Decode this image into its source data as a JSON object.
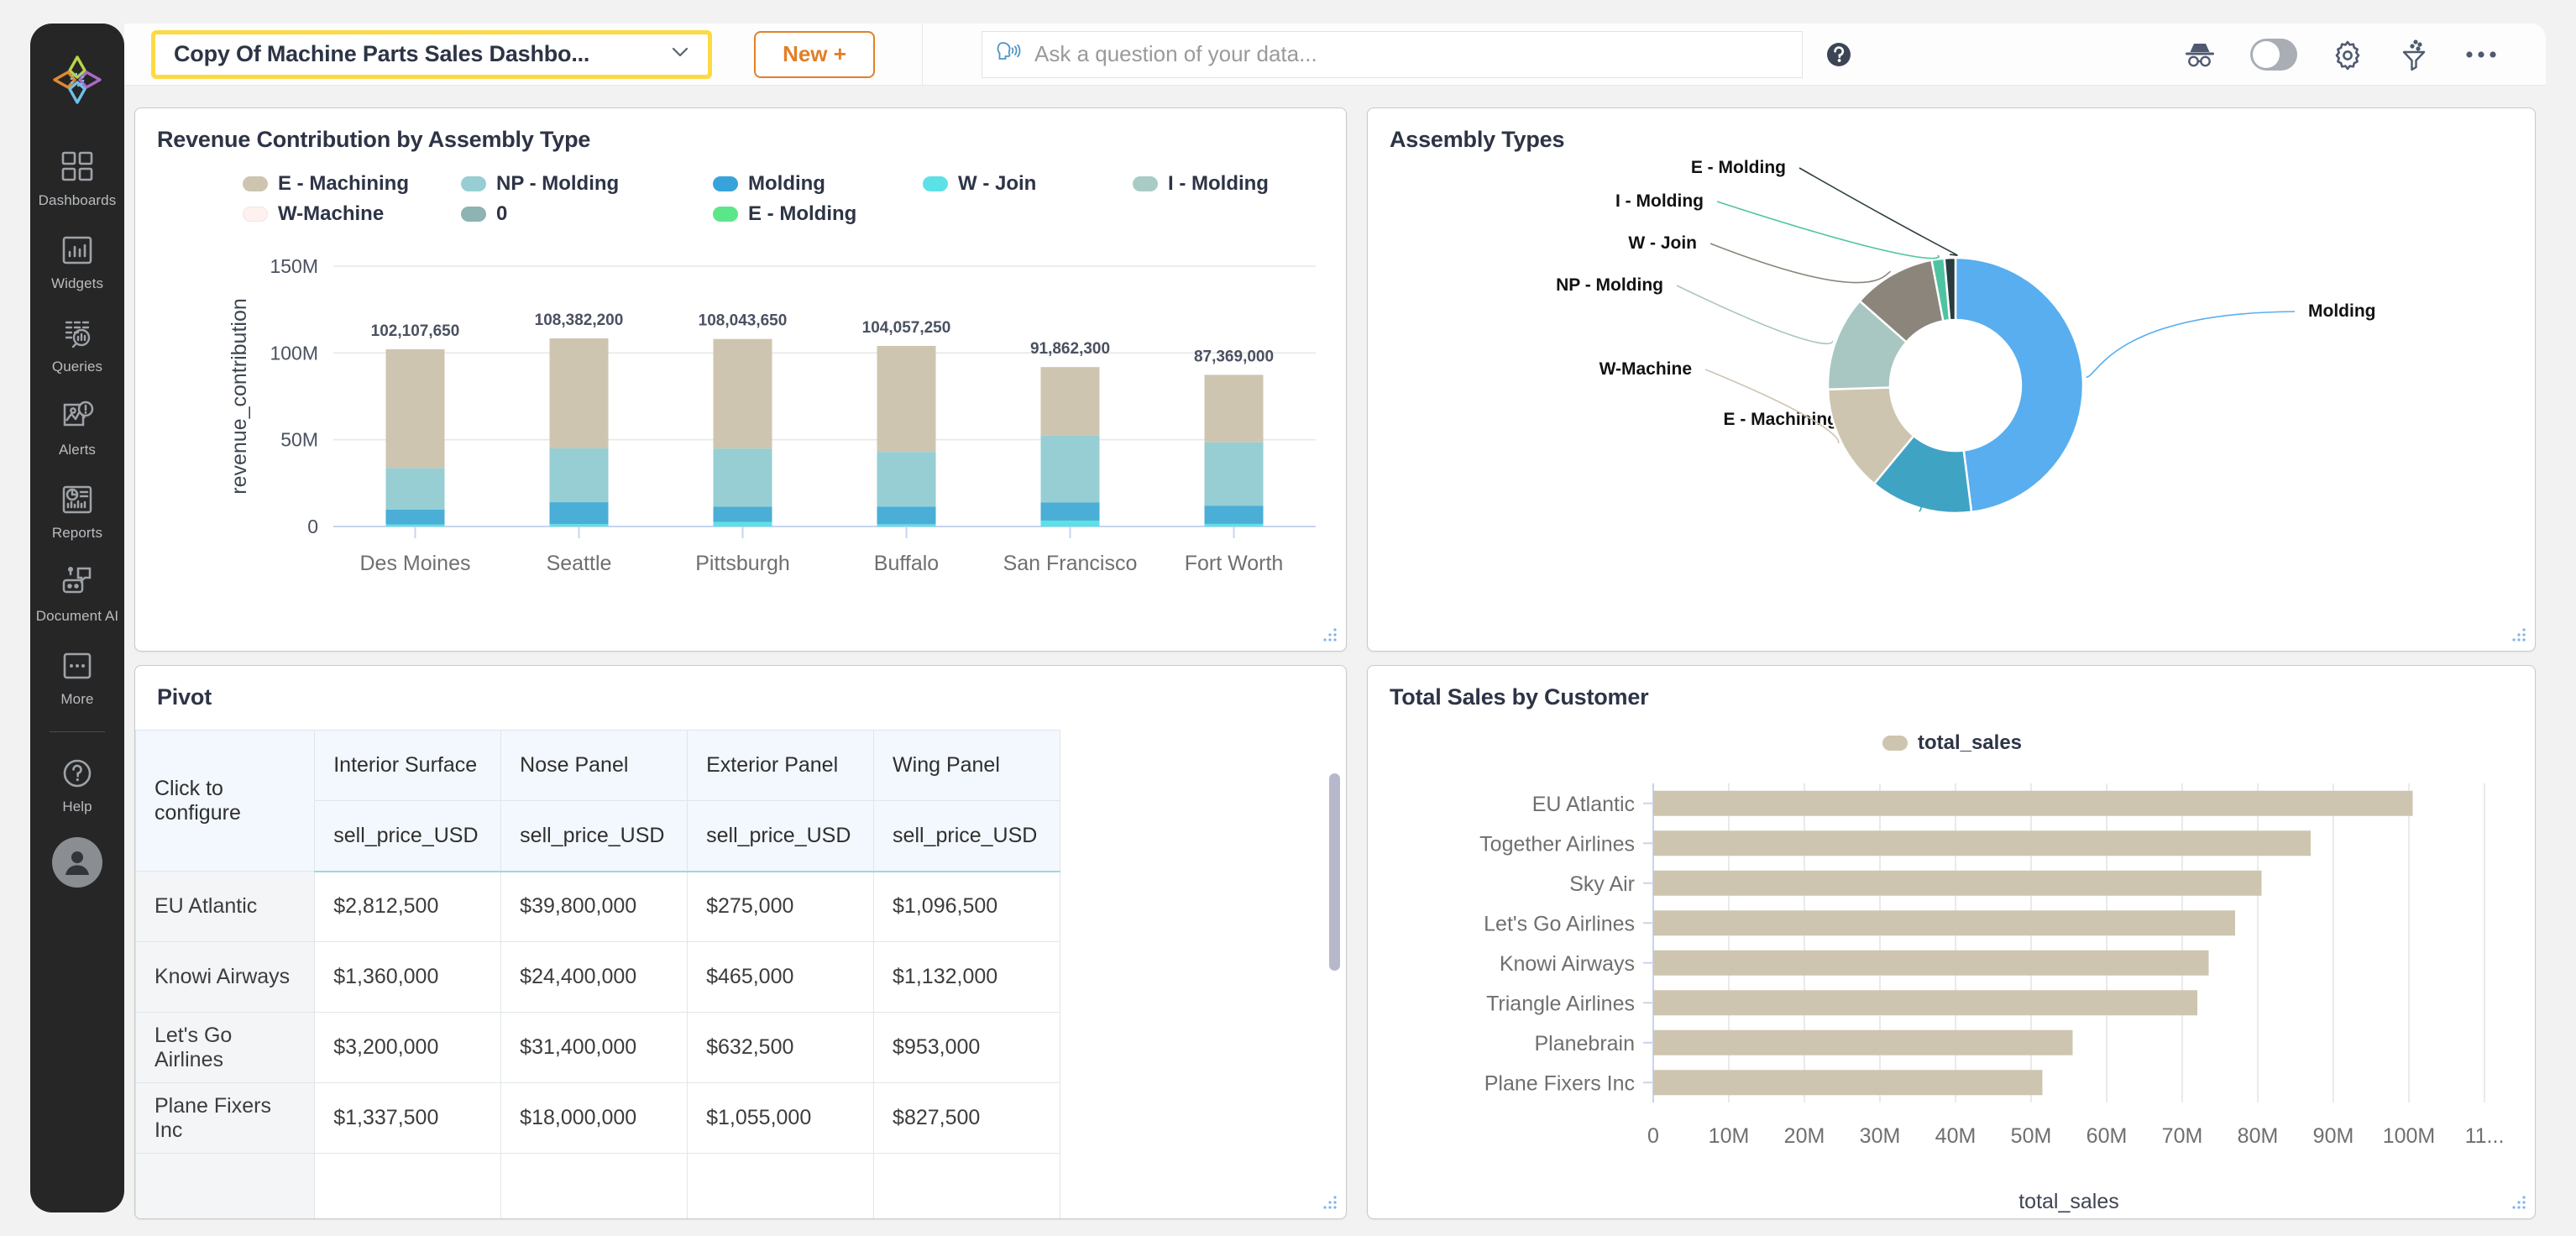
{
  "app": {
    "logo_icon": "knowi-star-logo"
  },
  "sidebar": {
    "items": [
      {
        "label": "Dashboards",
        "icon": "dashboards-icon"
      },
      {
        "label": "Widgets",
        "icon": "widgets-icon"
      },
      {
        "label": "Queries",
        "icon": "queries-icon"
      },
      {
        "label": "Alerts",
        "icon": "alerts-icon"
      },
      {
        "label": "Reports",
        "icon": "reports-icon"
      },
      {
        "label": "Document AI",
        "icon": "document-ai-icon"
      },
      {
        "label": "More",
        "icon": "more-icon"
      }
    ],
    "help": {
      "label": "Help",
      "icon": "help-circle-icon"
    },
    "avatar_icon": "user-avatar-icon"
  },
  "toolbar": {
    "dashboard_name": "Copy Of Machine Parts Sales Dashbo...",
    "dashboard_caret_icon": "chevron-down-icon",
    "new_label": "New +",
    "ask": {
      "placeholder": "Ask a question of your data...",
      "icon": "speak-head-icon"
    },
    "help_icon": "help-question-icon",
    "incognito_icon": "incognito-hat-icon",
    "toggle_icon": "toggle-switch",
    "settings_icon": "gear-icon",
    "filter_icon": "filter-funnel-icon",
    "more_icon": "ellipsis-icon",
    "highlight_color": "#ffd943",
    "new_button_color": "#e08028"
  },
  "panels": {
    "bar": {
      "title": "Revenue Contribution by Assembly Type",
      "resize_icon": "resize-handle-icon"
    },
    "donut": {
      "title": "Assembly Types",
      "resize_icon": "resize-handle-icon"
    },
    "pivot": {
      "title": "Pivot",
      "resize_icon": "resize-handle-icon"
    },
    "hbar": {
      "title": "Total Sales by Customer",
      "resize_icon": "resize-handle-icon"
    }
  },
  "pivot": {
    "corner_label": "Click to configure",
    "columns": [
      "Interior Surface",
      "Nose Panel",
      "Exterior Panel",
      "Wing Panel"
    ],
    "measure_label": "sell_price_USD",
    "rows": [
      {
        "name": "EU Atlantic",
        "values": [
          "$2,812,500",
          "$39,800,000",
          "$275,000",
          "$1,096,500"
        ]
      },
      {
        "name": "Knowi Airways",
        "values": [
          "$1,360,000",
          "$24,400,000",
          "$465,000",
          "$1,132,000"
        ]
      },
      {
        "name": "Let's Go Airlines",
        "values": [
          "$3,200,000",
          "$31,400,000",
          "$632,500",
          "$953,000"
        ]
      },
      {
        "name": "Plane Fixers Inc",
        "values": [
          "$1,337,500",
          "$18,000,000",
          "$1,055,000",
          "$827,500"
        ]
      }
    ]
  },
  "chart_data": [
    {
      "id": "revenue-contribution-bar",
      "type": "bar",
      "stacked": true,
      "title": "Revenue Contribution by Assembly Type",
      "xlabel": "",
      "ylabel": "revenue_contribution",
      "ylim": [
        0,
        150000000
      ],
      "yticks": [
        0,
        50000000,
        100000000,
        150000000
      ],
      "ytick_labels": [
        "0",
        "50M",
        "100M",
        "150M"
      ],
      "grid": true,
      "legend_position": "top",
      "categories": [
        "Des Moines",
        "Seattle",
        "Pittsburgh",
        "Buffalo",
        "San Francisco",
        "Fort Worth"
      ],
      "totals": [
        102107650,
        108382200,
        108043650,
        104057250,
        91862300,
        87369000
      ],
      "total_labels": [
        "102,107,650",
        "108,382,200",
        "108,043,650",
        "104,057,250",
        "91,862,300",
        "87,369,000"
      ],
      "series": [
        {
          "name": "W - Join",
          "color": "#5ce1e6",
          "values": [
            1200000,
            1400000,
            2600000,
            1300000,
            3400000,
            1500000
          ]
        },
        {
          "name": "Molding",
          "color": "#4aaed6",
          "values": [
            8500000,
            12600000,
            8800000,
            10200000,
            10400000,
            10500000
          ]
        },
        {
          "name": "NP - Molding",
          "color": "#96ced3",
          "values": [
            24000000,
            31000000,
            33500000,
            31500000,
            38800000,
            36500000
          ]
        },
        {
          "name": "E - Machining",
          "color": "#cec5b0",
          "values": [
            68407650,
            63382200,
            63143650,
            61057250,
            39262300,
            38869000
          ]
        },
        {
          "name": "W-Machine",
          "color": "#fdf2ee",
          "values": [
            0,
            0,
            0,
            0,
            0,
            0
          ]
        },
        {
          "name": "0",
          "color": "#8db3b2",
          "values": [
            0,
            0,
            0,
            0,
            0,
            0
          ]
        },
        {
          "name": "E - Molding",
          "color": "#5ce68a",
          "values": [
            0,
            0,
            0,
            0,
            0,
            0
          ]
        },
        {
          "name": "I - Molding",
          "color": "#a8ccc5",
          "values": [
            0,
            0,
            0,
            0,
            0,
            0
          ]
        }
      ],
      "legend": [
        {
          "label": "E - Machining",
          "color": "#cec5b0"
        },
        {
          "label": "NP - Molding",
          "color": "#96ced3"
        },
        {
          "label": "Molding",
          "color": "#38a3da"
        },
        {
          "label": "W - Join",
          "color": "#5ce1e6"
        },
        {
          "label": "I - Molding",
          "color": "#a8ccc5"
        },
        {
          "label": "W-Machine",
          "color": "#fdf2ee"
        },
        {
          "label": "0",
          "color": "#8db3b2"
        },
        {
          "label": "E - Molding",
          "color": "#5ce68a"
        }
      ]
    },
    {
      "id": "assembly-types-donut",
      "type": "pie",
      "donut": true,
      "title": "Assembly Types",
      "labels": [
        "Molding",
        "E - Machining",
        "W-Machine",
        "NP - Molding",
        "W - Join",
        "I - Molding",
        "E - Molding"
      ],
      "values": [
        48.0,
        13.0,
        13.5,
        12.0,
        10.5,
        1.6,
        1.4
      ],
      "colors": [
        "#58aeee",
        "#3fa3c4",
        "#cec5b0",
        "#a8c6c2",
        "#8b857b",
        "#4fc3a1",
        "#2b3c40"
      ],
      "legend_position": "callout-labels"
    },
    {
      "id": "total-sales-by-customer",
      "type": "bar",
      "orientation": "horizontal",
      "title": "Total Sales by Customer",
      "xlabel": "total_sales",
      "ylabel": "",
      "xlim": [
        0,
        110000000
      ],
      "xticks": [
        0,
        10000000,
        20000000,
        30000000,
        40000000,
        50000000,
        60000000,
        70000000,
        80000000,
        90000000,
        100000000,
        110000000
      ],
      "xtick_labels": [
        "0",
        "10M",
        "20M",
        "30M",
        "40M",
        "50M",
        "60M",
        "70M",
        "80M",
        "90M",
        "100M",
        "11..."
      ],
      "grid": true,
      "legend": [
        {
          "label": "total_sales",
          "color": "#cec5b0"
        }
      ],
      "categories": [
        "EU Atlantic",
        "Together Airlines",
        "Sky Air",
        "Let's Go Airlines",
        "Knowi Airways",
        "Triangle Airlines",
        "Planebrain",
        "Plane Fixers Inc"
      ],
      "values": [
        100500000,
        87000000,
        80500000,
        77000000,
        73500000,
        72000000,
        55500000,
        51500000
      ]
    }
  ]
}
